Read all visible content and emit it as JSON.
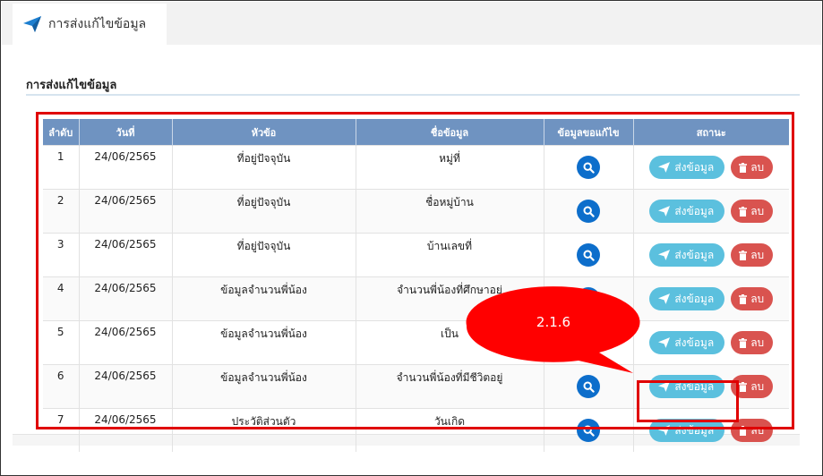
{
  "tab": {
    "label": "การส่งแก้ไขข้อมูล",
    "icon": "paper-plane-icon"
  },
  "section": {
    "title": "การส่งแก้ไขข้อมูล"
  },
  "table": {
    "headers": [
      "ลำดับ",
      "วันที่",
      "หัวข้อ",
      "ชื่อข้อมูล",
      "ข้อมูลขอแก้ไข",
      "สถานะ"
    ],
    "rows": [
      {
        "no": "1",
        "date": "24/06/2565",
        "topic": "ที่อยู่ปัจจุบัน",
        "name": "หมู่ที่"
      },
      {
        "no": "2",
        "date": "24/06/2565",
        "topic": "ที่อยู่ปัจจุบัน",
        "name": "ชื่อหมู่บ้าน"
      },
      {
        "no": "3",
        "date": "24/06/2565",
        "topic": "ที่อยู่ปัจจุบัน",
        "name": "บ้านเลขที่"
      },
      {
        "no": "4",
        "date": "24/06/2565",
        "topic": "ข้อมูลจำนวนพี่น้อง",
        "name": "จำนวนพี่น้องที่ศึกษาอยู่"
      },
      {
        "no": "5",
        "date": "24/06/2565",
        "topic": "ข้อมูลจำนวนพี่น้อง",
        "name": "เป็น"
      },
      {
        "no": "6",
        "date": "24/06/2565",
        "topic": "ข้อมูลจำนวนพี่น้อง",
        "name": "จำนวนพี่น้องที่มีชีวิตอยู่"
      },
      {
        "no": "7",
        "date": "24/06/2565",
        "topic": "ประวัติส่วนตัว",
        "name": "วันเกิด"
      }
    ],
    "view_icon": "search-icon",
    "send_label": "ส่งข้อมูล",
    "send_icon": "paper-plane-icon",
    "delete_label": "ลบ",
    "delete_icon": "trash-icon"
  },
  "annotation": {
    "label": "2.1.6"
  },
  "colors": {
    "header_bg": "#6f93c1",
    "view_button": "#0d6ecb",
    "send_button": "#5bc0de",
    "delete_button": "#d9534f",
    "highlight": "#e00000"
  }
}
